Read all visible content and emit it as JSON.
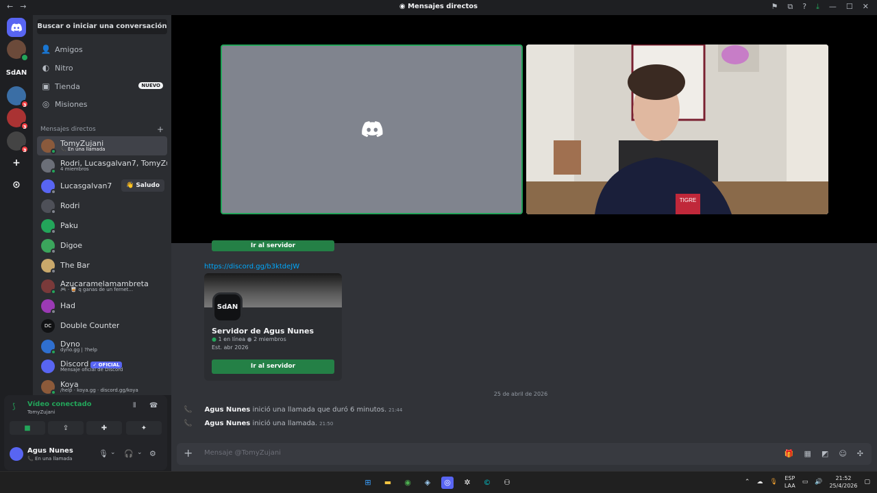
{
  "window": {
    "title": "Mensajes directos",
    "back_icon": "←",
    "forward_icon": "→",
    "controls": [
      "—",
      "☐",
      "✕"
    ]
  },
  "servers": {
    "items": [
      {
        "label": "",
        "badge": ""
      },
      {
        "label": "",
        "badge": ""
      },
      {
        "label": "SdAN",
        "badge": ""
      },
      {
        "label": "",
        "badge": "3"
      },
      {
        "label": "",
        "badge": "3"
      },
      {
        "label": "",
        "badge": "3"
      },
      {
        "label": "+",
        "badge": ""
      },
      {
        "label": "⊙",
        "badge": ""
      }
    ]
  },
  "sidebar": {
    "search_label": "Buscar o iniciar una conversación",
    "nav": [
      {
        "label": "Amigos",
        "icon": "👤"
      },
      {
        "label": "Nitro",
        "icon": "◐"
      },
      {
        "label": "Tienda",
        "icon": "▣",
        "badge": "NUEVO"
      },
      {
        "label": "Misiones",
        "icon": "◎"
      }
    ],
    "dm_header": "Mensajes directos",
    "dm_add": "+",
    "dms": [
      {
        "name": "TomyZujani",
        "sub": "📞 En una llamada",
        "color": "#8a5a3c"
      },
      {
        "name": "Rodri, Lucasgalvan7, TomyZujani",
        "sub": "4 miembros",
        "color": "#6b6f78"
      },
      {
        "name": "Lucasgalvan7",
        "sub": "",
        "color": "#5865f2"
      },
      {
        "name": "Rodri",
        "sub": "",
        "color": "#4e5058"
      },
      {
        "name": "Paku",
        "sub": "",
        "color": "#23a55a"
      },
      {
        "name": "Digoe",
        "sub": "",
        "color": "#3ba55c"
      },
      {
        "name": "The Bar",
        "sub": "",
        "color": "#c9a86b"
      },
      {
        "name": "Azucaramelamambreta",
        "sub": "🎮 · 🥃 q ganas de un fernet...",
        "color": "#7a3a3a"
      },
      {
        "name": "Had",
        "sub": "",
        "color": "#9b3ab5"
      },
      {
        "name": "Double Counter",
        "sub": "",
        "color": "#111214"
      },
      {
        "name": "Dyno",
        "sub": "dyno.gg | ?help",
        "color": "#2f6fcf"
      },
      {
        "name": "Discord",
        "sub": "Mensaje oficial de Discord",
        "color": "#5865f2",
        "tag": "✓ OFICIAL"
      },
      {
        "name": "Koya",
        "sub": "/help · koya.gg · discord.gg/koya",
        "color": "#8c5a3a"
      }
    ],
    "saludo_label": "👋 Saludo"
  },
  "voice": {
    "status": "Vídeo conectado",
    "channel": "TomyZujani"
  },
  "user": {
    "name": "Agus Nunes",
    "status": "📞 En una llamada"
  },
  "chat": {
    "top_button": "Ir al servidor",
    "link": "https://discord.gg/b3ktdeJW",
    "invite": {
      "icon_text": "SdAN",
      "server_name": "Servidor de Agus Nunes",
      "online": "1 en línea",
      "members": "2 miembros",
      "established": "Est. abr 2026",
      "button": "Ir al servidor"
    },
    "date_divider": "25 de abril de 2026",
    "messages": [
      {
        "author": "Agus Nunes",
        "text": "inició una llamada que duró 6 minutos.",
        "time": "21:44"
      },
      {
        "author": "Agus Nunes",
        "text": "inició una llamada.",
        "time": "21:50"
      }
    ],
    "placeholder": "Mensaje @TomyZujani"
  },
  "taskbar": {
    "lang": "ESP",
    "lang2": "LAA",
    "time": "21:52",
    "date": "25/4/2026"
  },
  "colors": {
    "accent": "#5865f2",
    "online": "#23a55a",
    "link": "#00a8fc",
    "button": "#248046"
  }
}
